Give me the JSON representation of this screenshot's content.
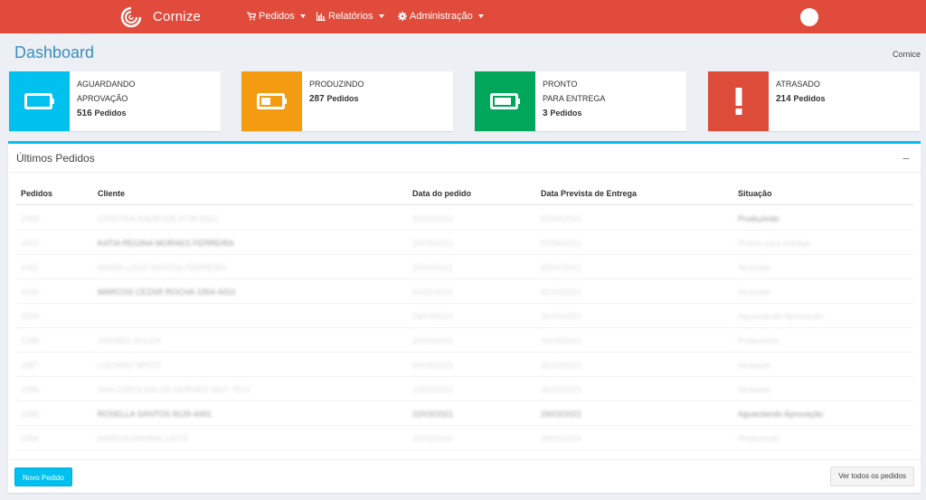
{
  "header": {
    "brand": "Cornize",
    "menu": [
      {
        "label": "Pedidos",
        "icon": "cart-icon"
      },
      {
        "label": "Relatórios",
        "icon": "bar-chart-icon"
      },
      {
        "label": "Administração",
        "icon": "gear-icon"
      }
    ]
  },
  "page": {
    "title": "Dashboard",
    "breadcrumb": "Cornice"
  },
  "stats": [
    {
      "label1": "AGUARDANDO",
      "label2": "APROVAÇÃO",
      "count": "516",
      "unit": "Pedidos",
      "color": "#00c0ef",
      "icon": "battery-empty-icon"
    },
    {
      "label1": "PRODUZINDO",
      "label2": "",
      "count": "287",
      "unit": "Pedidos",
      "color": "#f39c12",
      "icon": "battery-half-icon"
    },
    {
      "label1": "PRONTO",
      "label2": "PARA ENTREGA",
      "count": "3",
      "unit": "Pedidos",
      "color": "#00a65a",
      "icon": "battery-full-icon"
    },
    {
      "label1": "ATRASADO",
      "label2": "",
      "count": "214",
      "unit": "Pedidos",
      "color": "#dd4b39",
      "icon": "exclamation-icon"
    }
  ],
  "orders": {
    "title": "Últimos Pedidos",
    "collapse": "−",
    "columns": [
      "Pedidos",
      "Cliente",
      "Data do pedido",
      "Data Prevista de Entrega",
      "Situação"
    ],
    "rows": [
      [
        "2403",
        "CRISTINA ANDRADE 8738-6322",
        "25/03/2021",
        "05/04/2021",
        "Produzindo"
      ],
      [
        "2402",
        "KATIA REGINA MORAES FERREIRA",
        "25/03/2021",
        "05/04/2021",
        "Pronto para entrega"
      ],
      [
        "2401",
        "MARIA LUIZA SANTOS FERREIRA",
        "25/03/2021",
        "05/04/2021",
        "Atrasado"
      ],
      [
        "2400",
        "MARCOS CEZAR ROCHA 1954-4410",
        "24/03/2021",
        "31/03/2021",
        "Atrasado"
      ],
      [
        "2399",
        "",
        "24/03/2021",
        "31/03/2021",
        "Aguardando Aprovação"
      ],
      [
        "2398",
        "ANDREA SOUZA",
        "24/03/2021",
        "31/03/2021",
        "Produzindo"
      ],
      [
        "2397",
        "LUCIANO BRITO",
        "24/03/2021",
        "31/03/2021",
        "Atrasado"
      ],
      [
        "2396",
        "ANA CAROLINA DE MORAES 9837-7574",
        "23/03/2021",
        "30/03/2021",
        "Atrasado"
      ],
      [
        "2395",
        "ROSELLA SANTOS 8139-4491",
        "22/03/2021",
        "29/03/2021",
        "Aguardando Aprovação"
      ],
      [
        "2394",
        "MARCIA AMARAL LEITE",
        "22/03/2021",
        "29/03/2021",
        "Produzindo"
      ]
    ],
    "new_button": "Novo Pedido",
    "view_all_button": "Ver todos os pedidos"
  }
}
